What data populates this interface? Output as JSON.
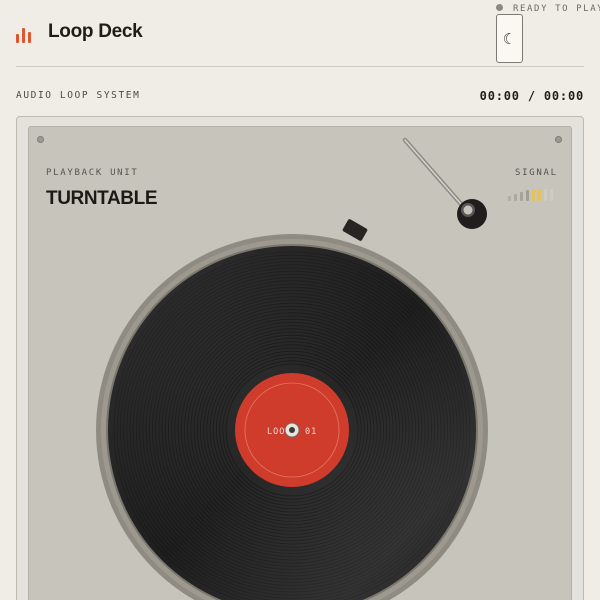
{
  "header": {
    "app_title": "Loop Deck",
    "status": "READY TO PLAY",
    "theme_toggle_icon": "☾"
  },
  "info": {
    "system_label": "AUDIO LOOP SYSTEM",
    "time_readout": "00:00 / 00:00"
  },
  "deck": {
    "unit_label": "PLAYBACK UNIT",
    "unit_name": "TURNTABLE",
    "signal_label": "SIGNAL",
    "record_label_left": "LOO",
    "record_label_right": "01"
  },
  "colors": {
    "accent": "#e0552e",
    "record_label": "#cf3c2c",
    "signal_active": "#e6c358"
  },
  "icons": [
    "logo-bars-icon",
    "moon-icon",
    "screw-icon"
  ]
}
